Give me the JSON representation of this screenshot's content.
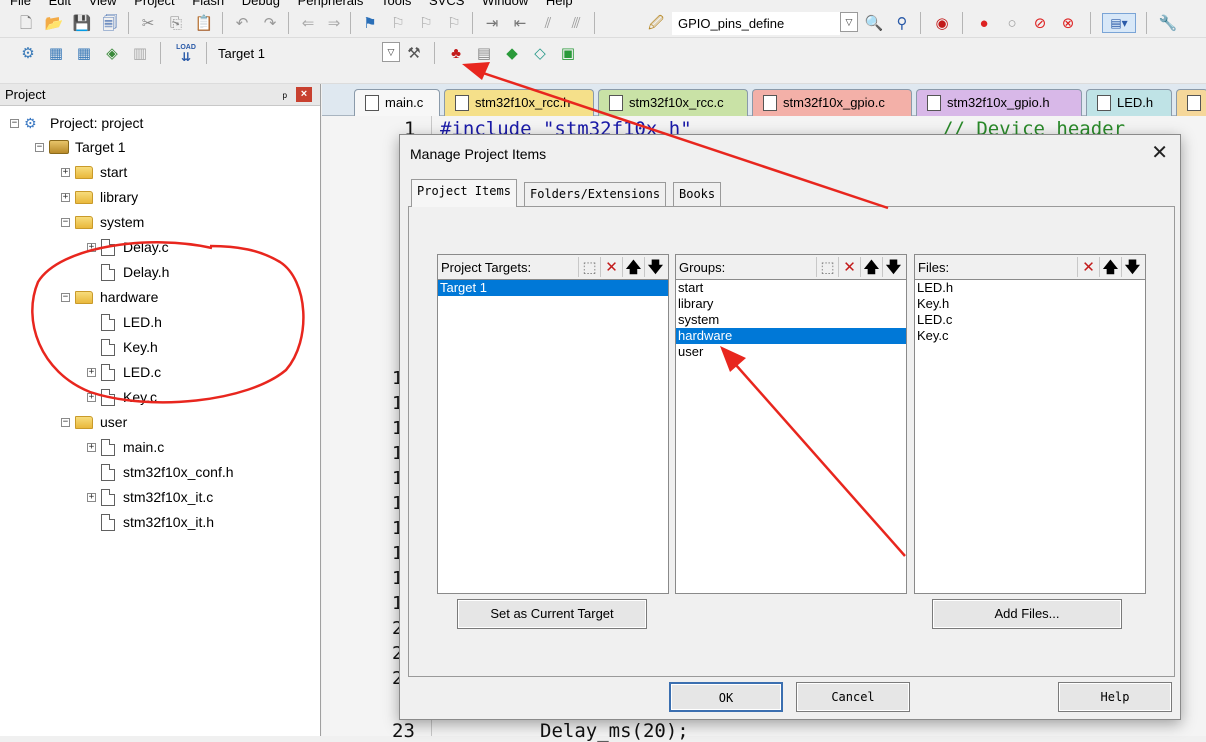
{
  "menu": [
    "File",
    "Edit",
    "View",
    "Project",
    "Flash",
    "Debug",
    "Peripherals",
    "Tools",
    "SVCS",
    "Window",
    "Help"
  ],
  "toolbar": {
    "build_combo": "GPIO_pins_define",
    "target_combo": "Target 1",
    "load_label": "LOAD"
  },
  "project_panel": {
    "title": "Project",
    "pin": "ᵖ",
    "close": "×",
    "root": "Project: project",
    "target": "Target 1",
    "groups": [
      "start",
      "library",
      "system",
      "hardware",
      "user"
    ],
    "system_files": [
      "Delay.c",
      "Delay.h"
    ],
    "hardware_files": [
      "LED.h",
      "Key.h",
      "LED.c",
      "Key.c"
    ],
    "user_files": [
      "main.c",
      "stm32f10x_conf.h",
      "stm32f10x_it.c",
      "stm32f10x_it.h"
    ]
  },
  "tabs": [
    {
      "label": "main.c",
      "color": "#f7f7f7"
    },
    {
      "label": "stm32f10x_rcc.h",
      "color": "#f5e08a"
    },
    {
      "label": "stm32f10x_rcc.c",
      "color": "#c9e2a6"
    },
    {
      "label": "stm32f10x_gpio.c",
      "color": "#f3b0a8"
    },
    {
      "label": "stm32f10x_gpio.h",
      "color": "#d8b8e8"
    },
    {
      "label": "LED.h",
      "color": "#bfe3e6"
    },
    {
      "label": "",
      "color": "#f5d79a"
    }
  ],
  "editor": {
    "line1_no": "1",
    "line1_code": "#include \"stm32f10x.h\"",
    "line1_comment": "// Device header",
    "last_line_no": "23",
    "last_line_code": "Delay_ms(20);",
    "gutter_ones": [
      "1",
      "1",
      "1",
      "1",
      "1",
      "1",
      "1",
      "1",
      "1",
      "1"
    ],
    "gutter_twos": [
      "2",
      "2",
      "2"
    ]
  },
  "dialog": {
    "title": "Manage Project Items",
    "close": "✕",
    "tabs": [
      "Project Items",
      "Folders/Extensions",
      "Books"
    ],
    "targets_label": "Project Targets:",
    "groups_label": "Groups:",
    "files_label": "Files:",
    "targets": [
      "Target 1"
    ],
    "groups": [
      "start",
      "library",
      "system",
      "hardware",
      "user"
    ],
    "files": [
      "LED.h",
      "Key.h",
      "LED.c",
      "Key.c"
    ],
    "set_target": "Set as Current Target",
    "add_files": "Add Files...",
    "ok": "OK",
    "cancel": "Cancel",
    "help": "Help"
  },
  "annotation_color": "#e8261e"
}
